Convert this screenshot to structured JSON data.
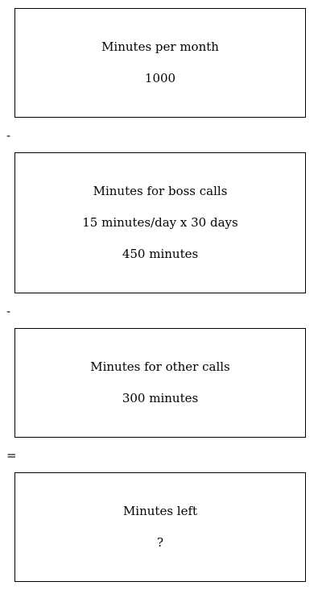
{
  "diagram": {
    "boxes": [
      {
        "lines": [
          "Minutes per month",
          "1000"
        ]
      },
      {
        "lines": [
          "Minutes for boss calls",
          "15 minutes/day x 30 days",
          "450 minutes"
        ]
      },
      {
        "lines": [
          "Minutes for other calls",
          "300 minutes"
        ]
      },
      {
        "lines": [
          "Minutes left",
          "?"
        ]
      }
    ],
    "operators": [
      "-",
      "-",
      "="
    ]
  }
}
